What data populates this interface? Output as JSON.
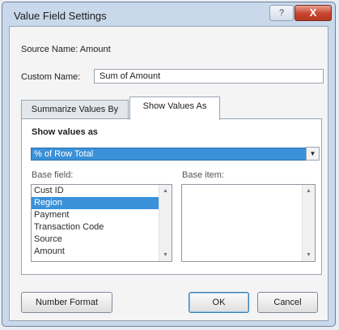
{
  "dialog": {
    "title": "Value Field Settings",
    "help_label": "?",
    "close_label": "X"
  },
  "source": {
    "label": "Source Name:  Amount"
  },
  "custom_name": {
    "label": "Custom Name:",
    "value": "Sum of Amount"
  },
  "tabs": [
    {
      "label": "Summarize Values By"
    },
    {
      "label": "Show Values As"
    }
  ],
  "show_values": {
    "section_title": "Show values as",
    "selected": "% of Row Total",
    "dropdown_arrow": "▼"
  },
  "base_field": {
    "label": "Base field:",
    "items": [
      "Cust ID",
      "Region",
      "Payment",
      "Transaction Code",
      "Source",
      "Amount"
    ],
    "selected_index": 1
  },
  "base_item": {
    "label": "Base item:",
    "items": []
  },
  "buttons": {
    "number_format": "Number Format",
    "ok": "OK",
    "cancel": "Cancel"
  },
  "colors": {
    "accent": "#3a91d9",
    "titlebar": "#c9d8eb",
    "close": "#c6452e"
  }
}
